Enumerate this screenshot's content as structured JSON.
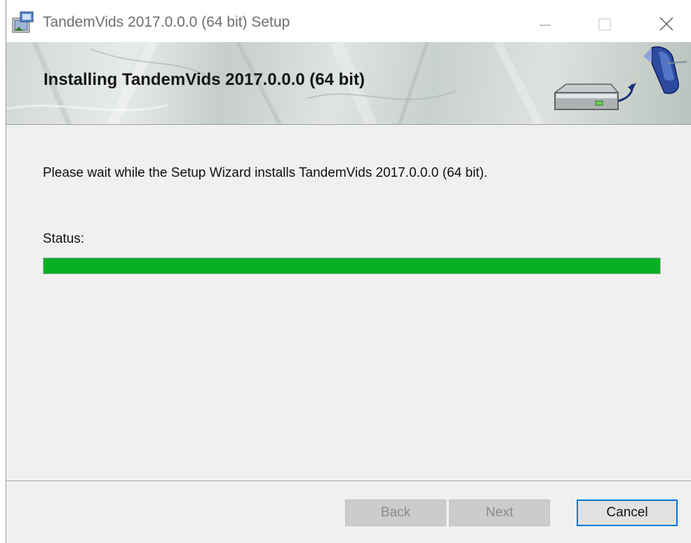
{
  "window": {
    "title": "TandemVids 2017.0.0.0 (64 bit) Setup",
    "icon": "installer-package-icon"
  },
  "titlebar": {
    "minimize_icon": "minimize-icon",
    "maximize_icon": "maximize-icon",
    "close_icon": "close-icon"
  },
  "banner": {
    "title": "Installing TandemVids 2017.0.0.0 (64 bit)",
    "art_icon": "hard-drive-install-icon"
  },
  "main": {
    "description": "Please wait while the Setup Wizard installs TandemVids 2017.0.0.0 (64 bit).",
    "status_label": "Status:",
    "progress_percent": 100,
    "progress_color": "#06b025"
  },
  "footer": {
    "back_label": "Back",
    "next_label": "Next",
    "cancel_label": "Cancel",
    "accent_color": "#0078d7"
  }
}
